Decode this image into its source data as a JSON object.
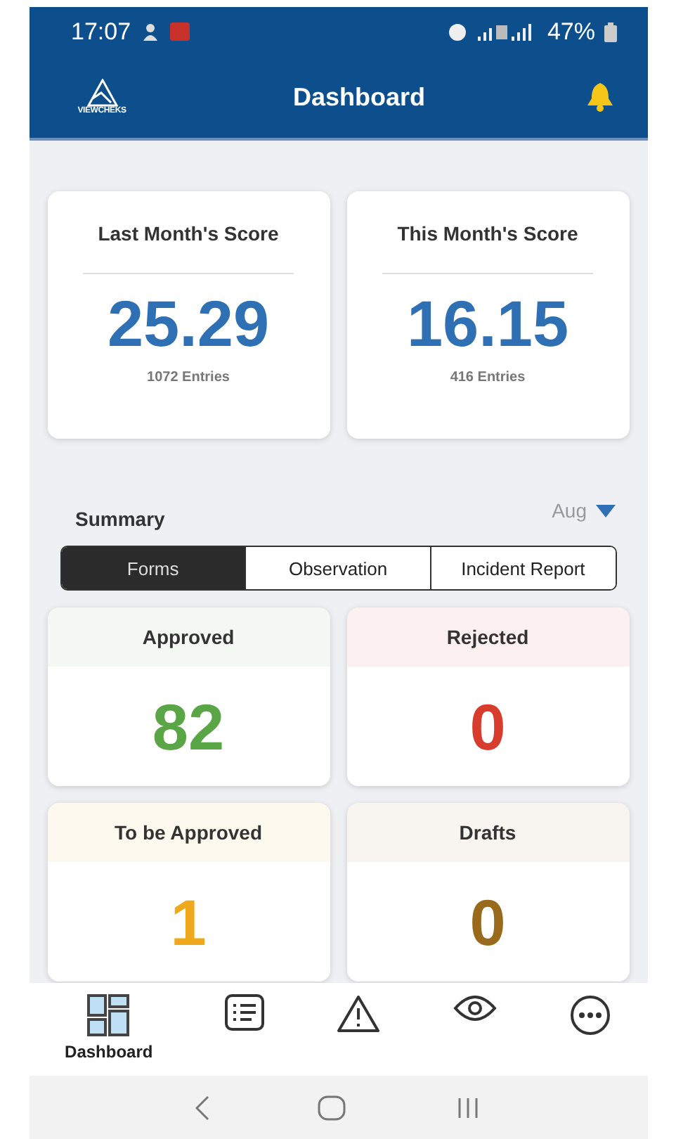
{
  "status_bar": {
    "time": "17:07",
    "battery": "47%"
  },
  "app_bar": {
    "logo_text": "VIEWCHEKS",
    "title": "Dashboard"
  },
  "scores": [
    {
      "title": "Last Month's Score",
      "value": "25.29",
      "entries": "1072 Entries"
    },
    {
      "title": "This Month's Score",
      "value": "16.15",
      "entries": "416 Entries"
    }
  ],
  "summary": {
    "title": "Summary",
    "month": "Aug"
  },
  "tabs": [
    {
      "label": "Forms",
      "selected": true
    },
    {
      "label": "Observation",
      "selected": false
    },
    {
      "label": "Incident Report",
      "selected": false
    }
  ],
  "stats": [
    {
      "label": "Approved",
      "value": "82",
      "color": "#5aa545"
    },
    {
      "label": "Rejected",
      "value": "0",
      "color": "#d83c2c"
    },
    {
      "label": "To be Approved",
      "value": "1",
      "color": "#f0a91c"
    },
    {
      "label": "Drafts",
      "value": "0",
      "color": "#9a6a1c"
    }
  ],
  "bottom_nav": [
    {
      "kind": "dashboard",
      "label": "Dashboard",
      "selected": true
    },
    {
      "kind": "list",
      "selected": false
    },
    {
      "kind": "warning",
      "selected": false
    },
    {
      "kind": "eye",
      "selected": false
    },
    {
      "kind": "more",
      "selected": false
    }
  ]
}
